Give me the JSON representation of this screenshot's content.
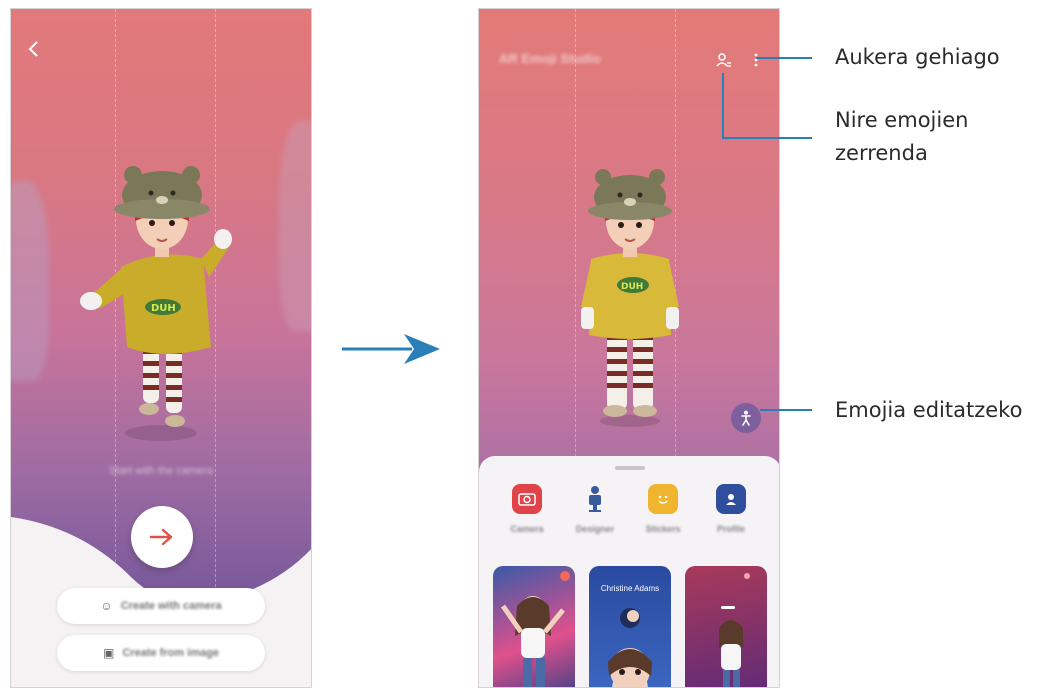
{
  "left_screen": {
    "back_icon": "chevron-left-icon",
    "start_caption": "Start with the camera",
    "next_icon": "arrow-right-icon",
    "create_with_camera_label": "Create with camera",
    "create_from_image_label": "Create from image"
  },
  "right_screen": {
    "title": "AR Emoji Studio",
    "my_emojis_icon": "person-list-icon",
    "more_options_icon": "more-vertical-icon",
    "edit_icon": "person-figure-icon",
    "menu": [
      {
        "label": "Camera",
        "icon": "camera-icon"
      },
      {
        "label": "Designer",
        "icon": "designer-icon"
      },
      {
        "label": "Stickers",
        "icon": "sticker-icon"
      },
      {
        "label": "Profile",
        "icon": "profile-icon"
      }
    ],
    "thumbnails": [
      {
        "caption": ""
      },
      {
        "caption": "Christine Adams"
      },
      {
        "caption": ""
      }
    ]
  },
  "annotations": {
    "more_options": "Aukera gehiago",
    "my_emojis_line1": "Nire emojien",
    "my_emojis_line2": "zerrenda",
    "edit_emoji": "Emojia editatzeko"
  },
  "colors": {
    "accent_blue": "#2a7fb8",
    "next_arrow": "#e0504a",
    "camera_red": "#e0444a",
    "designer_blue": "#3a5a9e",
    "sticker_yellow": "#f1b42e",
    "profile_navy": "#2f4f9e"
  }
}
